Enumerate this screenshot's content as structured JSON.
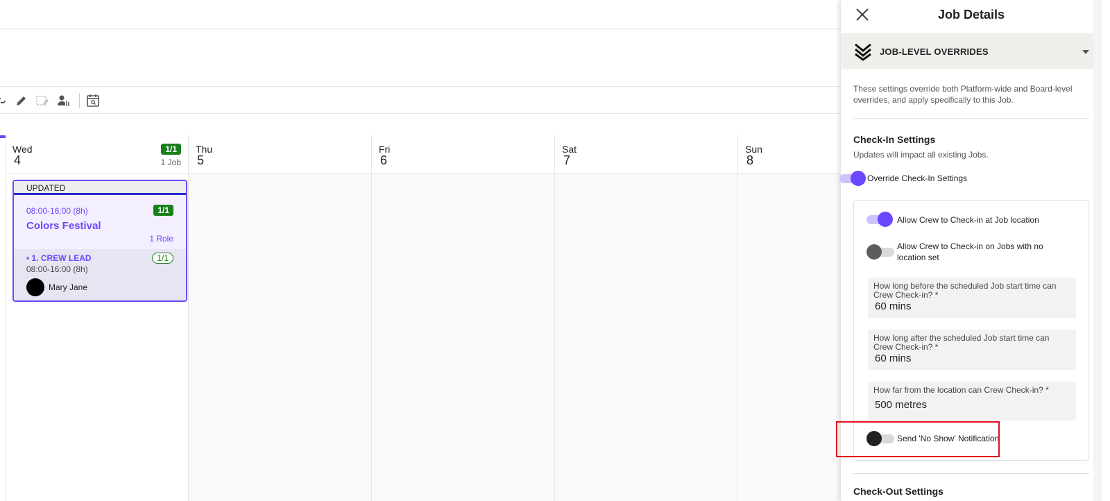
{
  "calendar": {
    "days": [
      {
        "name": "Wed",
        "num": "4",
        "badge": "1/1",
        "count": "1 Job"
      },
      {
        "name": "Thu",
        "num": "5"
      },
      {
        "name": "Fri",
        "num": "6"
      },
      {
        "name": "Sat",
        "num": "7"
      },
      {
        "name": "Sun",
        "num": "8"
      }
    ],
    "job": {
      "status": "UPDATED",
      "time": "08:00-16:00 (8h)",
      "badge": "1/1",
      "title": "Colors Festival",
      "roles": "1 Role",
      "role": {
        "title": "• 1. CREW LEAD",
        "badge": "1/1",
        "time": "08:00-16:00 (8h)",
        "crew": "Mary Jane"
      }
    }
  },
  "toolbar": {
    "icons": [
      "link-icon",
      "pencil-icon",
      "calendar-edit-icon",
      "user-sort-icon",
      "calendar-search-icon"
    ]
  },
  "panel": {
    "title": "Job Details",
    "accordion_title": "JOB-LEVEL OVERRIDES",
    "description": "These settings override both Platform-wide and Board-level overrides, and apply specifically to this Job.",
    "section_title": "Check-In Settings",
    "section_subtitle": "Updates will impact all existing Jobs.",
    "override_label": "Override Check-In Settings",
    "allow_location_label": "Allow Crew to Check-in at Job location",
    "allow_no_location_label": "Allow Crew to Check-in on Jobs with no location set",
    "field_before_label": "How long before the scheduled Job start time can Crew Check-in? *",
    "field_before_value": "60 mins",
    "field_after_label": "How long after the scheduled Job start time can Crew Check-in? *",
    "field_after_value": "60 mins",
    "field_distance_label": "How far from the location can Crew Check-in? *",
    "field_distance_value": "500 metres",
    "no_show_label": "Send 'No Show' Notification",
    "next_section": "Check-Out Settings"
  },
  "colors": {
    "accent": "#6c47ff",
    "badge_green": "#1a7f1a",
    "highlight_red": "#e0101a"
  }
}
